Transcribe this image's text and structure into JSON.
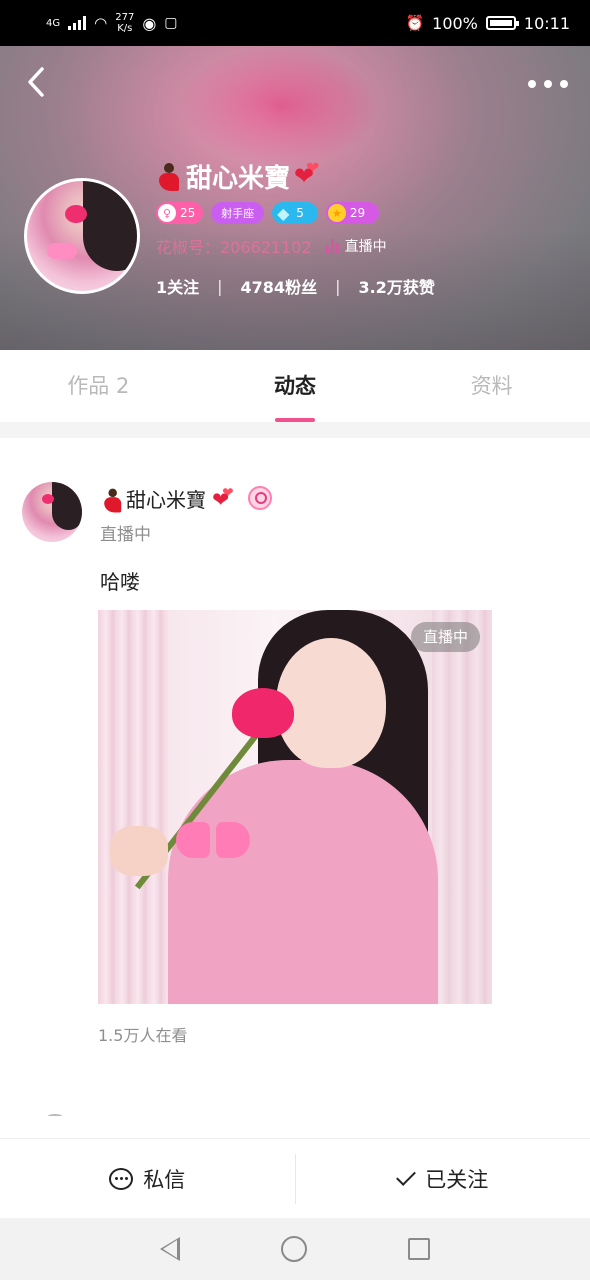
{
  "status_bar": {
    "network": "4G",
    "speed_value": "277",
    "speed_unit": "K/s",
    "battery": "100%",
    "time": "10:11"
  },
  "profile": {
    "name": "甜心米寶",
    "level": "25",
    "zodiac": "射手座",
    "diamond": "5",
    "star_level": "29",
    "id_text": "花椒号：206621102",
    "live_status": "直播中",
    "following": "1关注",
    "fans": "4784粉丝",
    "likes": "3.2万获赞",
    "separator": "|"
  },
  "tabs": [
    {
      "label": "作品 2",
      "active": false
    },
    {
      "label": "动态",
      "active": true
    },
    {
      "label": "资料",
      "active": false
    }
  ],
  "post": {
    "author": "甜心米寶",
    "status": "直播中",
    "text": "哈喽",
    "image_tag": "直播中",
    "viewers": "1.5万人在看"
  },
  "actions": {
    "message_label": "私信",
    "follow_label": "已关注"
  },
  "colors": {
    "accent": "#f0528d",
    "level_badge": "#ff5fa8",
    "zodiac_badge": "#c95ef0",
    "diamond_badge": "#2bb8ef",
    "star_badge": "#d659e6"
  }
}
